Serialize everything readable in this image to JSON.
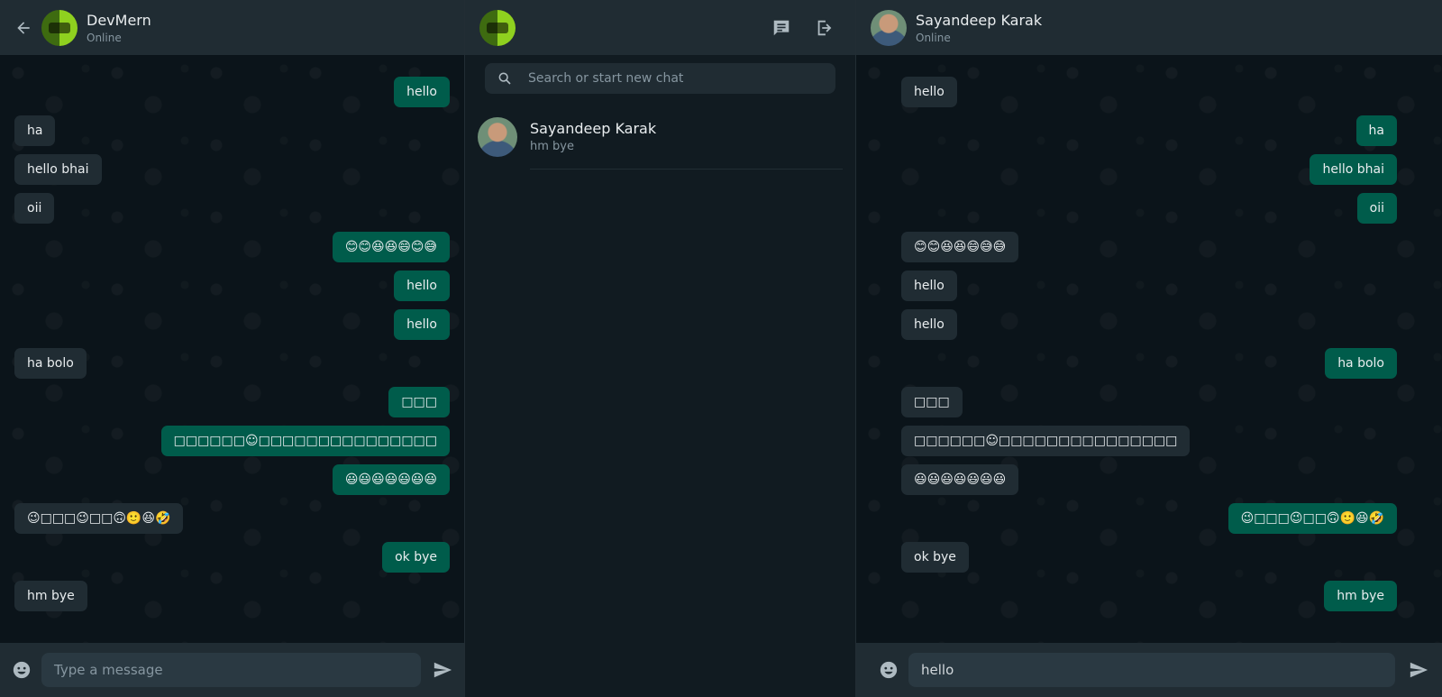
{
  "left_chat": {
    "contact_name": "DevMern",
    "status": "Online",
    "messages": [
      {
        "dir": "out",
        "text": "hello"
      },
      {
        "dir": "in",
        "text": "ha"
      },
      {
        "dir": "in",
        "text": "hello bhai"
      },
      {
        "dir": "in",
        "text": "oii"
      },
      {
        "dir": "out",
        "text": "😊😊😆😆😄😊😅"
      },
      {
        "dir": "out",
        "text": "hello"
      },
      {
        "dir": "out",
        "text": "hello"
      },
      {
        "dir": "in",
        "text": "ha bolo"
      },
      {
        "dir": "out",
        "text": "□□□"
      },
      {
        "dir": "out",
        "text": "□□□□□□☺□□□□□□□□□□□□□□□"
      },
      {
        "dir": "out",
        "text": "😃😃😃😃😃😃😃"
      },
      {
        "dir": "in",
        "text": "😉□□□😉□□🙃🙂😆🤣"
      },
      {
        "dir": "out",
        "text": "ok bye"
      },
      {
        "dir": "in",
        "text": "hm bye"
      }
    ],
    "input_placeholder": "Type a message",
    "input_value": ""
  },
  "sidebar": {
    "search_placeholder": "Search or start new chat",
    "chats": [
      {
        "name": "Sayandeep Karak",
        "last_message": "hm bye"
      }
    ]
  },
  "right_chat": {
    "contact_name": "Sayandeep Karak",
    "status": "Online",
    "messages": [
      {
        "dir": "in",
        "text": "hello"
      },
      {
        "dir": "out",
        "text": "ha"
      },
      {
        "dir": "out",
        "text": "hello bhai"
      },
      {
        "dir": "out",
        "text": "oii"
      },
      {
        "dir": "in",
        "text": "😊😊😆😆😄😅😅"
      },
      {
        "dir": "in",
        "text": "hello"
      },
      {
        "dir": "in",
        "text": "hello"
      },
      {
        "dir": "out",
        "text": "ha bolo"
      },
      {
        "dir": "in",
        "text": "□□□"
      },
      {
        "dir": "in",
        "text": "□□□□□□☺□□□□□□□□□□□□□□□"
      },
      {
        "dir": "in",
        "text": "😃😃😃😃😃😃😃"
      },
      {
        "dir": "out",
        "text": "😉□□□😉□□🙃🙂😆🤣"
      },
      {
        "dir": "in",
        "text": "ok bye"
      },
      {
        "dir": "out",
        "text": "hm bye"
      }
    ],
    "input_placeholder": "",
    "input_value": "hello"
  },
  "icons": {
    "back": "arrow-left-icon",
    "new_chat": "new-chat-icon",
    "logout": "logout-icon",
    "search": "search-icon",
    "emoji": "emoji-icon",
    "send": "send-icon"
  },
  "colors": {
    "app_bg": "#0b141a",
    "header_bg": "#202c33",
    "bubble_in": "#202c33",
    "bubble_out": "#005c4b",
    "muted_text": "#8696a0"
  }
}
